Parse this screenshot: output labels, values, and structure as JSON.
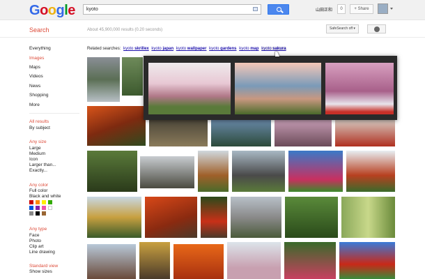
{
  "header": {
    "logo_letters": [
      "G",
      "o",
      "o",
      "g",
      "l",
      "e"
    ],
    "logo_colors": [
      "#3369e8",
      "#d50f25",
      "#eeb211",
      "#3369e8",
      "#009925",
      "#d50f25"
    ],
    "query": "kyoto",
    "user_name": "山田正和",
    "notification_count": "0",
    "share_label": "+ Share"
  },
  "subheader": {
    "search_label": "Search",
    "result_stats": "About 45,900,000 results (0.20 seconds)",
    "safesearch_label": "SafeSearch off ▾"
  },
  "sidebar": {
    "services": [
      "Everything",
      "Images",
      "Maps",
      "Videos",
      "News",
      "Shopping",
      "More"
    ],
    "selected_service": "Images",
    "results_filter": {
      "heading": "All results",
      "option": "By subject"
    },
    "size_filter": {
      "heading": "Any size",
      "options": [
        "Large",
        "Medium",
        "Icon",
        "Larger than...",
        "Exactly..."
      ]
    },
    "color_filter": {
      "heading": "Any color",
      "options": [
        "Full color",
        "Black and white"
      ],
      "swatches": [
        "#cc0000",
        "#ff8800",
        "#ffee00",
        "#33aa00",
        "#0055dd",
        "#8822aa",
        "#ee55aa",
        "#ffffff",
        "#888888",
        "#000000",
        "#996633"
      ]
    },
    "type_filter": {
      "heading": "Any type",
      "options": [
        "Face",
        "Photo",
        "Clip art",
        "Line drawing"
      ]
    },
    "view_filter": {
      "heading": "Standard view",
      "option": "Show sizes"
    }
  },
  "related": {
    "label": "Related searches:",
    "items": [
      {
        "base": "kyoto",
        "bold": "skrillex"
      },
      {
        "base": "kyoto",
        "bold": "japan"
      },
      {
        "base": "kyoto",
        "bold": "wallpaper"
      },
      {
        "base": "kyoto",
        "bold": "gardens"
      },
      {
        "base": "kyoto",
        "bold": "map"
      },
      {
        "base": "kyoto",
        "bold": "sakura"
      }
    ]
  },
  "colors": {
    "accent_red": "#dd4b39",
    "link_blue": "#1a0dab",
    "search_button": "#4c87ee",
    "popup_bg": "#2a2a2a"
  }
}
